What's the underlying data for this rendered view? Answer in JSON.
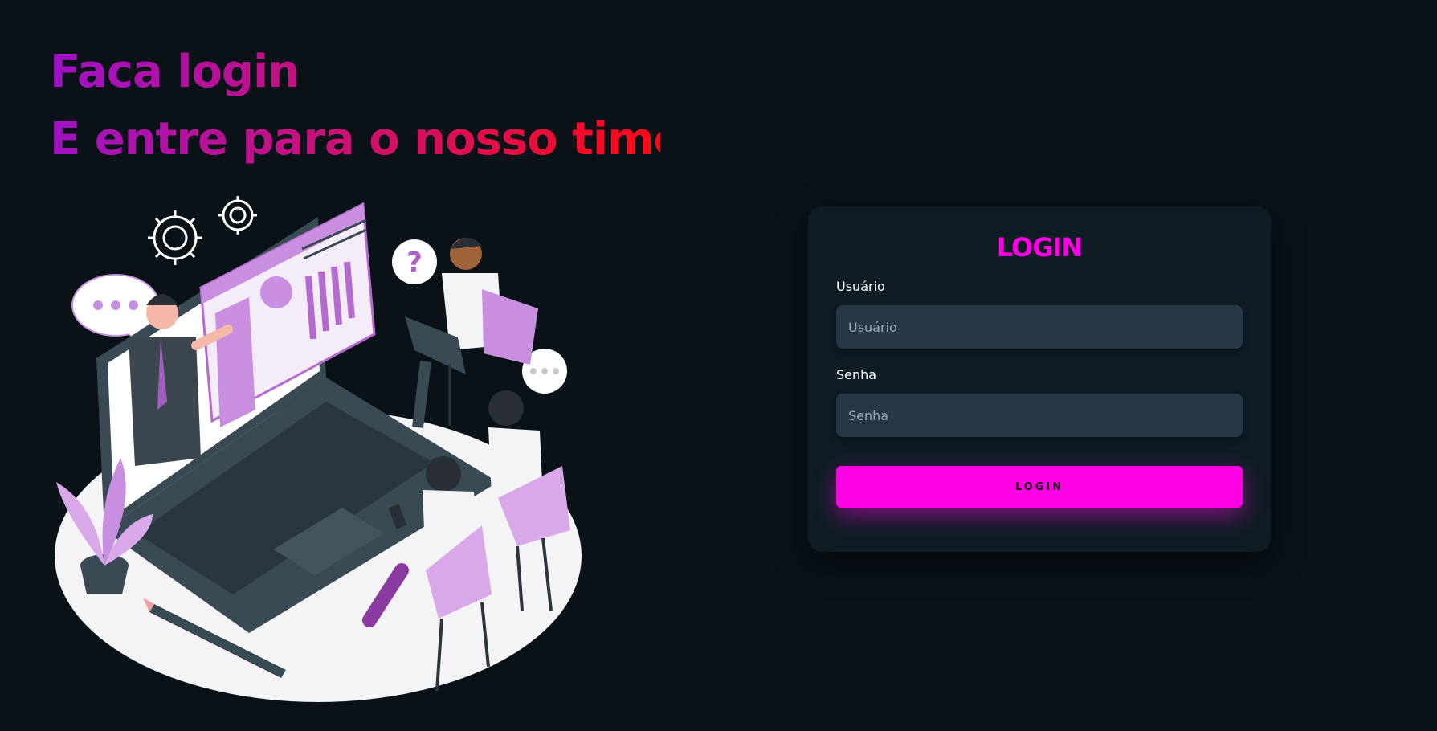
{
  "heading": {
    "line1": "Faca login",
    "line2": "E entre para o nosso time."
  },
  "illustration": {
    "icon": "team-online-meeting-illustration"
  },
  "login_card": {
    "title": "LOGIN",
    "username_label": "Usuário",
    "username_placeholder": "Usuário",
    "password_label": "Senha",
    "password_placeholder": "Senha",
    "button_label": "LOGIN"
  },
  "colors": {
    "background": "#0a1218",
    "card": "#0f1c24",
    "input": "#263846",
    "accent": "#ff00e6",
    "heading_gradient_start": "#9f12c8",
    "heading_gradient_end": "#ff0a14"
  }
}
